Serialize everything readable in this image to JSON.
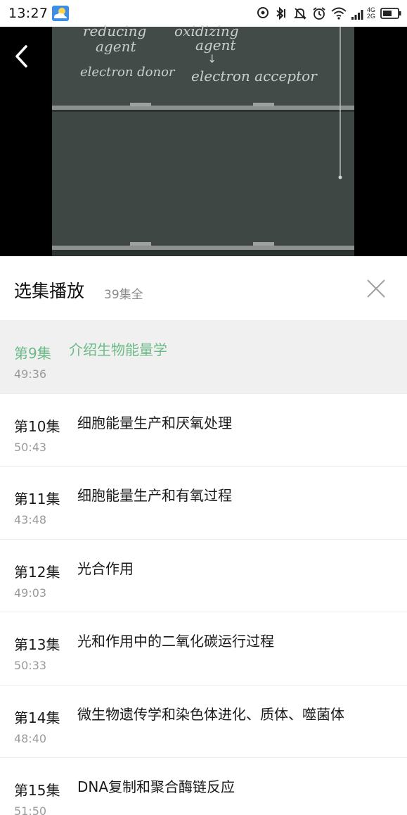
{
  "status_bar": {
    "time": "13:27",
    "network_top": "4G",
    "network_bottom": "2G",
    "icons": [
      "weather-icon",
      "location-icon",
      "bluetooth-icon",
      "mute-icon",
      "alarm-icon",
      "wifi-icon",
      "signal-icon",
      "battery-icon"
    ]
  },
  "video": {
    "chalk_lines": [
      "reducing",
      "agent",
      "oxidizing",
      "agent",
      "electron donor",
      "electron acceptor"
    ],
    "colors": {
      "board": "#3f4744",
      "chalk": "#c9cec9"
    }
  },
  "panel": {
    "title": "选集播放",
    "count": "39集全"
  },
  "episodes": [
    {
      "num": "第9集",
      "title": "介绍生物能量学",
      "duration": "49:36",
      "active": true
    },
    {
      "num": "第10集",
      "title": "细胞能量生产和厌氧处理",
      "duration": "50:43"
    },
    {
      "num": "第11集",
      "title": "细胞能量生产和有氧过程",
      "duration": "43:48"
    },
    {
      "num": "第12集",
      "title": "光合作用",
      "duration": "49:03"
    },
    {
      "num": "第13集",
      "title": "光和作用中的二氧化碳运行过程",
      "duration": "50:33"
    },
    {
      "num": "第14集",
      "title": "微生物遗传学和染色体进化、质体、噬菌体",
      "duration": "48:40"
    },
    {
      "num": "第15集",
      "title": "DNA复制和聚合酶链反应",
      "duration": "51:50"
    }
  ],
  "colors": {
    "accent": "#6cb987",
    "active_bg": "#f0f0f0"
  }
}
